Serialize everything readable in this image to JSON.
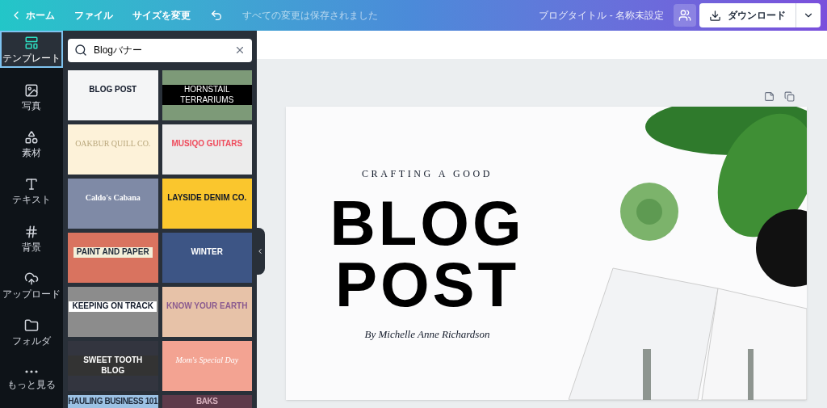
{
  "topbar": {
    "back": "ホーム",
    "menu": [
      "ファイル",
      "サイズを変更"
    ],
    "save_status": "すべての変更は保存されました",
    "doc_title": "ブログタイトル - 名称未設定",
    "download": "ダウンロード"
  },
  "rail": [
    {
      "kind": "template",
      "label": "テンプレート",
      "selected": true
    },
    {
      "kind": "photo",
      "label": "写真",
      "selected": false
    },
    {
      "kind": "elements",
      "label": "素材",
      "selected": false
    },
    {
      "kind": "text",
      "label": "テキスト",
      "selected": false
    },
    {
      "kind": "background",
      "label": "背景",
      "selected": false
    },
    {
      "kind": "upload",
      "label": "アップロード",
      "selected": false
    },
    {
      "kind": "folder",
      "label": "フォルダ",
      "selected": false
    },
    {
      "kind": "more",
      "label": "もっと見る",
      "selected": false
    }
  ],
  "search": {
    "value": "Blogバナー"
  },
  "templates": [
    {
      "title": "BLOG POST",
      "color": "#f4f5f6"
    },
    {
      "title": "HORNSTAIL TERRARIUMS",
      "color": "#7d9a78"
    },
    {
      "title": "OAKBUR QUILL CO.",
      "color": "#fdf2d9"
    },
    {
      "title": "MUSIQO GUITARS",
      "color": "#ececec"
    },
    {
      "title": "Caldo's Cabana",
      "color": "#7f8aa6"
    },
    {
      "title": "LAYSIDE DENIM CO.",
      "color": "#fac62d"
    },
    {
      "title": "PAINT AND PAPER",
      "color": "#d9735f"
    },
    {
      "title": "WINTER",
      "color": "#3d5585"
    },
    {
      "title": "KEEPING ON TRACK",
      "color": "#8c8c8c"
    },
    {
      "title": "KNOW YOUR EARTH",
      "color": "#e7c2a8"
    },
    {
      "title": "SWEET TOOTH BLOG",
      "color": "#33353f"
    },
    {
      "title": "Mom's Special Day",
      "color": "#f3a392"
    },
    {
      "title": "HAULING BUSINESS 101",
      "color": "#9cc2e4"
    },
    {
      "title": "BAKS",
      "color": "#5e3a4a"
    }
  ],
  "canvas": {
    "kicker": "CRAFTING A GOOD",
    "title_lines": [
      "BLOG",
      "POST"
    ],
    "byline": "By Michelle Anne Richardson"
  }
}
